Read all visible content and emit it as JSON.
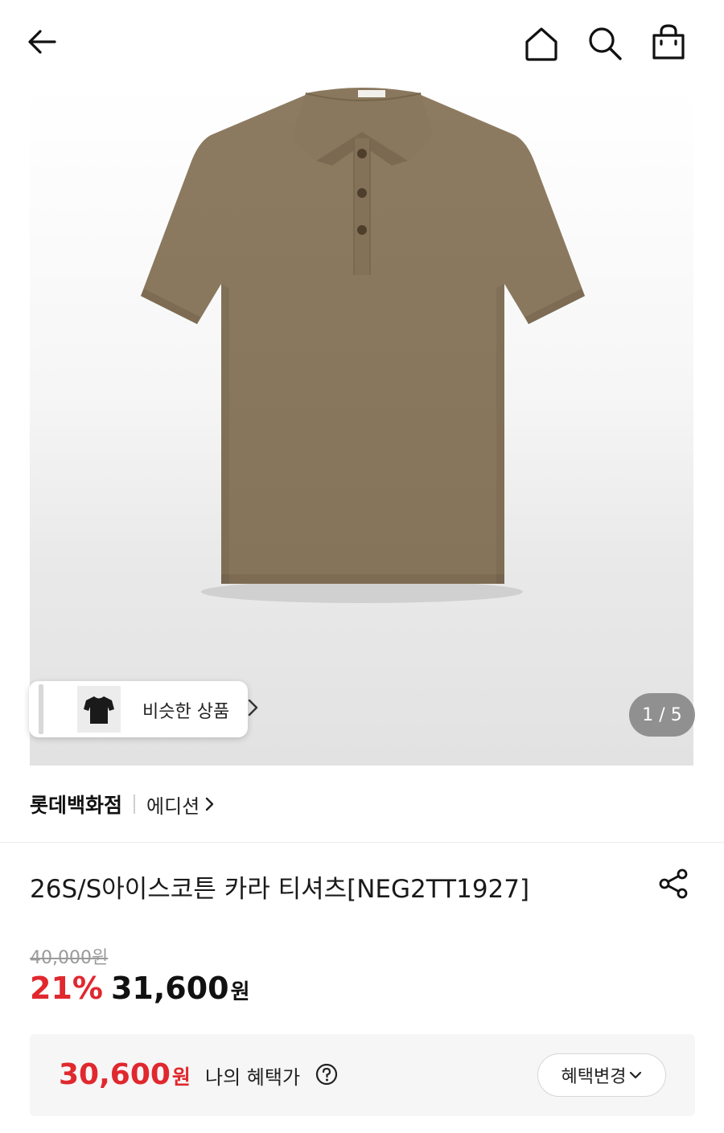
{
  "header": {
    "back_icon": "arrow-left-icon",
    "home_icon": "home-icon",
    "search_icon": "search-icon",
    "cart_icon": "shopping-bag-icon"
  },
  "gallery": {
    "current": 1,
    "total": 5,
    "counter": "1 / 5",
    "similar_label": "비슷한 상품",
    "product_color": "#8c7a60"
  },
  "brand": {
    "main": "롯데백화점",
    "sub": "에디션"
  },
  "product": {
    "title": "26S/S아이스코튼 카라 티셔츠[NEG2TT1927]"
  },
  "pricing": {
    "original": "40,000원",
    "discount": "21%",
    "sale_amount": "31,600",
    "sale_unit": "원"
  },
  "benefit": {
    "amount": "30,600",
    "unit": "원",
    "label": "나의 혜택가",
    "change_button": "혜택변경"
  },
  "colors": {
    "accent_red": "#e0282e"
  }
}
